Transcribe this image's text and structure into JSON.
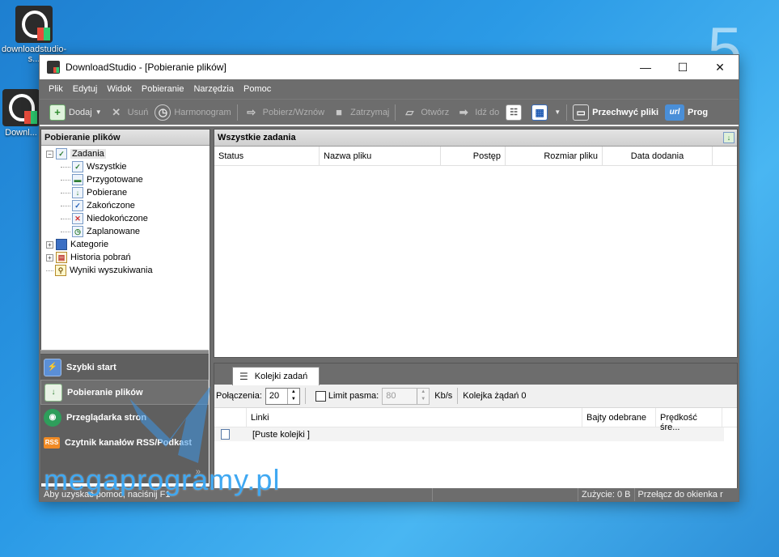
{
  "desktop": {
    "icons": [
      {
        "label": "downloadstudio-s..."
      },
      {
        "label": "Downl..."
      }
    ],
    "corner_number": "5"
  },
  "window": {
    "title": "DownloadStudio - [Pobieranie plików]",
    "controls": {
      "minimize": "—",
      "maximize": "☐",
      "close": "✕"
    }
  },
  "menu": [
    "Plik",
    "Edytuj",
    "Widok",
    "Pobieranie",
    "Narzędzia",
    "Pomoc"
  ],
  "toolbar": {
    "add": "Dodaj",
    "delete": "Usuń",
    "schedule": "Harmonogram",
    "download_resume": "Pobierz/Wznów",
    "stop": "Zatrzymaj",
    "open": "Otwórz",
    "goto": "Idź do",
    "capture": "Przechwyć pliki",
    "url": "url",
    "prog": "Prog"
  },
  "left_panel": {
    "title": "Pobieranie plików",
    "tree": {
      "tasks": "Zadania",
      "children": [
        "Wszystkie",
        "Przygotowane",
        "Pobierane",
        "Zakończone",
        "Niedokończone",
        "Zaplanowane"
      ],
      "categories": "Kategorie",
      "history": "Historia pobrań",
      "search_results": "Wyniki wyszukiwania"
    }
  },
  "nav": {
    "items": [
      {
        "label": "Szybki start"
      },
      {
        "label": "Pobieranie plików"
      },
      {
        "label": "Przeglądarka stron"
      },
      {
        "label": "Czytnik kanałów RSS/Podkast"
      }
    ],
    "more": "»",
    "rss_badge": "RSS"
  },
  "tasks_panel": {
    "title": "Wszystkie zadania",
    "columns": [
      "Status",
      "Nazwa pliku",
      "Postęp",
      "Rozmiar pliku",
      "Data dodania"
    ]
  },
  "queue_panel": {
    "tab": "Kolejki zadań",
    "connections_label": "Połączenia:",
    "connections_value": "20",
    "limit_label": "Limit pasma:",
    "limit_value": "80",
    "unit": "Kb/s",
    "queue_info": "Kolejka żądań 0",
    "columns": [
      "Linki",
      "Bajty odebrane",
      "Prędkość śre..."
    ],
    "empty_row": "[Puste kolejki ]"
  },
  "statusbar": {
    "help": "Aby uzyskać pomoc, naciśnij F1",
    "usage": "Zużycie: 0 B",
    "switch": "Przełącz do okienka r"
  },
  "watermark": "megaprogramy.pl"
}
